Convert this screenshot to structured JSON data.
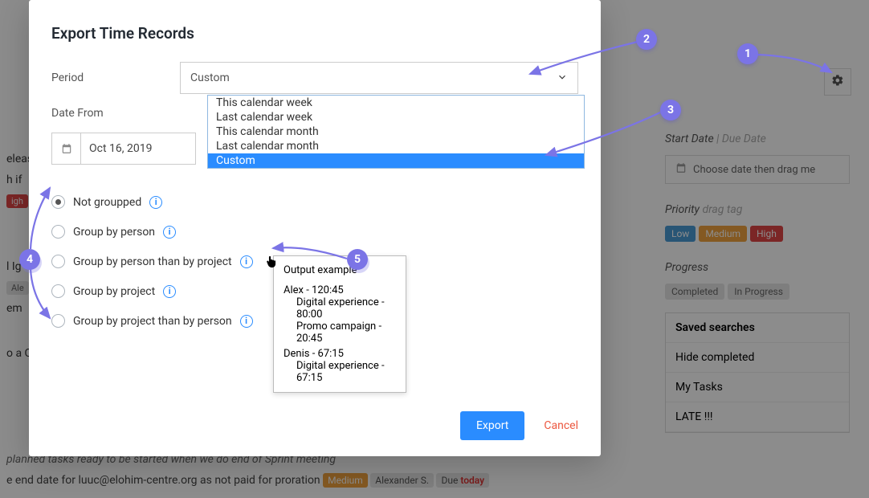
{
  "modal": {
    "title": "Export Time Records",
    "period_label": "Period",
    "period_value": "Custom",
    "date_from_label": "Date From",
    "date_from_value": "Oct 16, 2019",
    "dropdown_options": [
      "This calendar week",
      "Last calendar week",
      "This calendar month",
      "Last calendar month",
      "Custom"
    ],
    "radios": [
      "Not groupped",
      "Group by person",
      "Group by person than by project",
      "Group by project",
      "Group by project than by person"
    ],
    "export_label": "Export",
    "cancel_label": "Cancel"
  },
  "tooltip": {
    "title": "Output example",
    "lines": [
      {
        "t": "Alex - 120:45",
        "indent": 0
      },
      {
        "t": "Digital experience - 80:00",
        "indent": 1
      },
      {
        "t": "Promo campaign - 20:45",
        "indent": 1
      },
      {
        "t": "Denis - 67:15",
        "indent": 0
      },
      {
        "t": "Digital experience - 67:15",
        "indent": 1
      }
    ]
  },
  "sidebar": {
    "start_date_label": "Start Date",
    "due_date_label": "Due Date",
    "choose_date": "Choose date then drag me",
    "priority_label": "Priority",
    "priority_hint": "drag tag",
    "priority_low": "Low",
    "priority_med": "Medium",
    "priority_high": "High",
    "progress_label": "Progress",
    "progress_completed": "Completed",
    "progress_inprogress": "In Progress",
    "saved_header": "Saved searches",
    "saved_items": [
      "Hide completed",
      "My Tasks",
      "LATE !!!"
    ]
  },
  "bg": {
    "left_fragments": [
      "elease",
      "h if",
      "igh",
      "l  Ig",
      "Ale",
      "em",
      "o a C"
    ],
    "bottom_line1": "planned tasks ready to be started when we do end of Sprint meeting",
    "bottom_line2_a": "e end date for luuc@elohim-centre.org as not paid for proration",
    "bottom_line2_tag1": "Medium",
    "bottom_line2_tag2": "Alexander S.",
    "bottom_line2_due": "Due ",
    "bottom_line2_today": "today"
  },
  "annotations": [
    "1",
    "2",
    "3",
    "4",
    "5"
  ]
}
